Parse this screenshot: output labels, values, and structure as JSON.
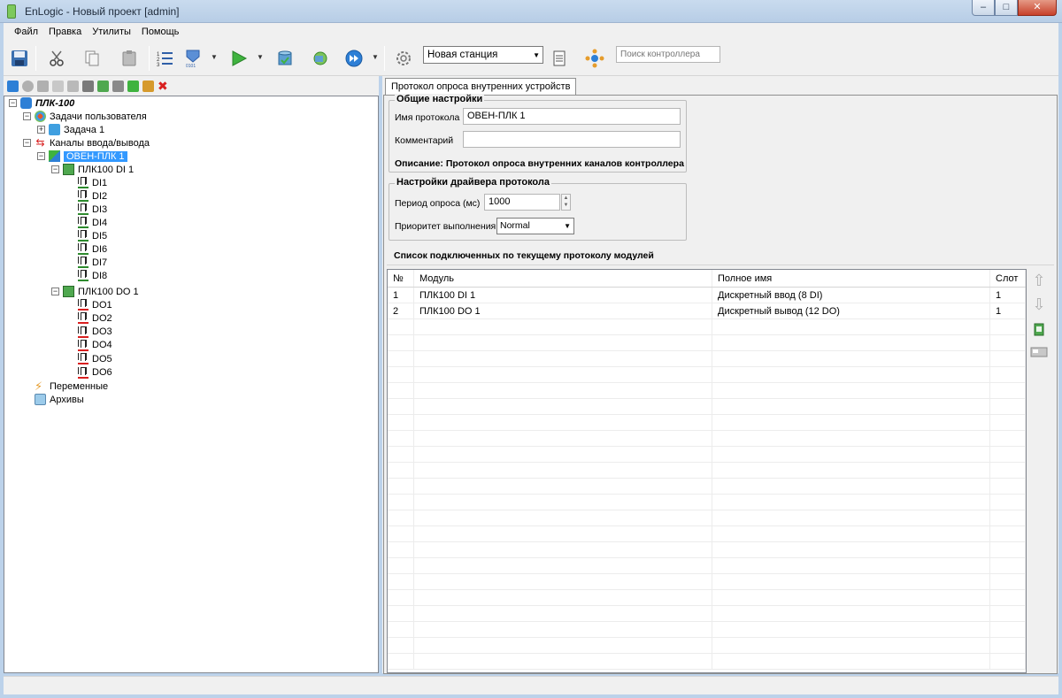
{
  "window": {
    "title": "EnLogic - Новый проект [admin]",
    "buttons": {
      "minimize": "–",
      "maximize": "□",
      "close": "✕"
    }
  },
  "menu": [
    "Файл",
    "Правка",
    "Утилиты",
    "Помощь"
  ],
  "toolbar": {
    "station_select": "Новая станция",
    "search_placeholder": "Поиск контроллера"
  },
  "tree": {
    "root": "ПЛК-100",
    "user_tasks": "Задачи пользователя",
    "task1": "Задача 1",
    "io_channels": "Каналы ввода/вывода",
    "protocol": "ОВЕН-ПЛК 1",
    "module_di": "ПЛК100 DI 1",
    "di_items": [
      "DI1",
      "DI2",
      "DI3",
      "DI4",
      "DI5",
      "DI6",
      "DI7",
      "DI8"
    ],
    "module_do": "ПЛК100 DO 1",
    "do_items": [
      "DO1",
      "DO2",
      "DO3",
      "DO4",
      "DO5",
      "DO6"
    ],
    "variables": "Переменные",
    "archives": "Архивы"
  },
  "tab": {
    "label": "Протокол опроса внутренних устройств"
  },
  "general": {
    "legend": "Общие настройки",
    "protocol_name_label": "Имя протокола",
    "protocol_name_value": "ОВЕН-ПЛК 1",
    "comment_label": "Комментарий",
    "comment_value": "",
    "description": "Описание: Протокол опроса внутренних каналов контроллера"
  },
  "driver": {
    "legend": "Настройки драйвера протокола",
    "period_label": "Период опроса (мс)",
    "period_value": "1000",
    "priority_label": "Приоритет выполнения",
    "priority_value": "Normal"
  },
  "modules": {
    "title": "Список подключенных по текущему протоколу модулей",
    "columns": [
      "№",
      "Модуль",
      "Полное имя",
      "Слот"
    ],
    "rows": [
      {
        "num": "1",
        "module": "ПЛК100 DI 1",
        "full_name": "Дискретный ввод (8 DI)",
        "slot": "1"
      },
      {
        "num": "2",
        "module": "ПЛК100 DO 1",
        "full_name": "Дискретный вывод (12 DO)",
        "slot": "1"
      }
    ]
  },
  "colors": {
    "selection": "#3399ff",
    "input_arrow": "#2e8b2e",
    "output_arrow": "#d92020",
    "window_frame": "#bcd2ea"
  }
}
